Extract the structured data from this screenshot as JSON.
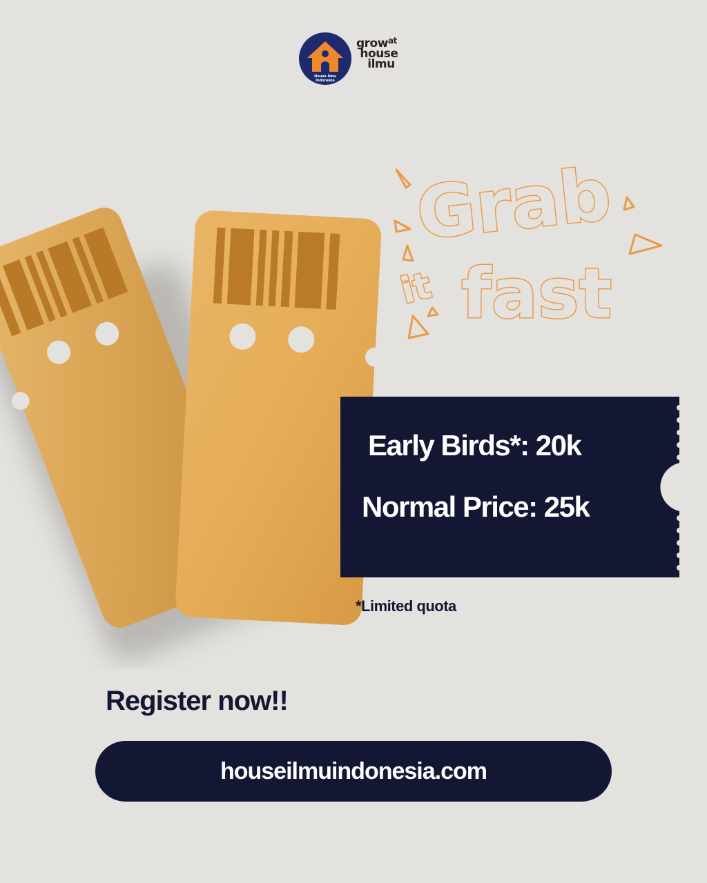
{
  "logo": {
    "badge_line1": "House Ilmu",
    "badge_line2": "Indonesia",
    "wordmark": [
      "grow",
      "at",
      "house",
      "ilmu"
    ]
  },
  "headline": {
    "grab": "Grab",
    "it": "it",
    "fast": "fast"
  },
  "pricing": {
    "early": "Early Birds*: 20k",
    "normal": "Normal Price: 25k",
    "note": "*Limited quota"
  },
  "cta": {
    "heading": "Register now!!",
    "url": "houseilmuindonesia.com"
  },
  "colors": {
    "background": "#e4e2de",
    "navy": "#141733",
    "orange_outline": "#ea9a45",
    "gold": "#e3ae5a"
  }
}
